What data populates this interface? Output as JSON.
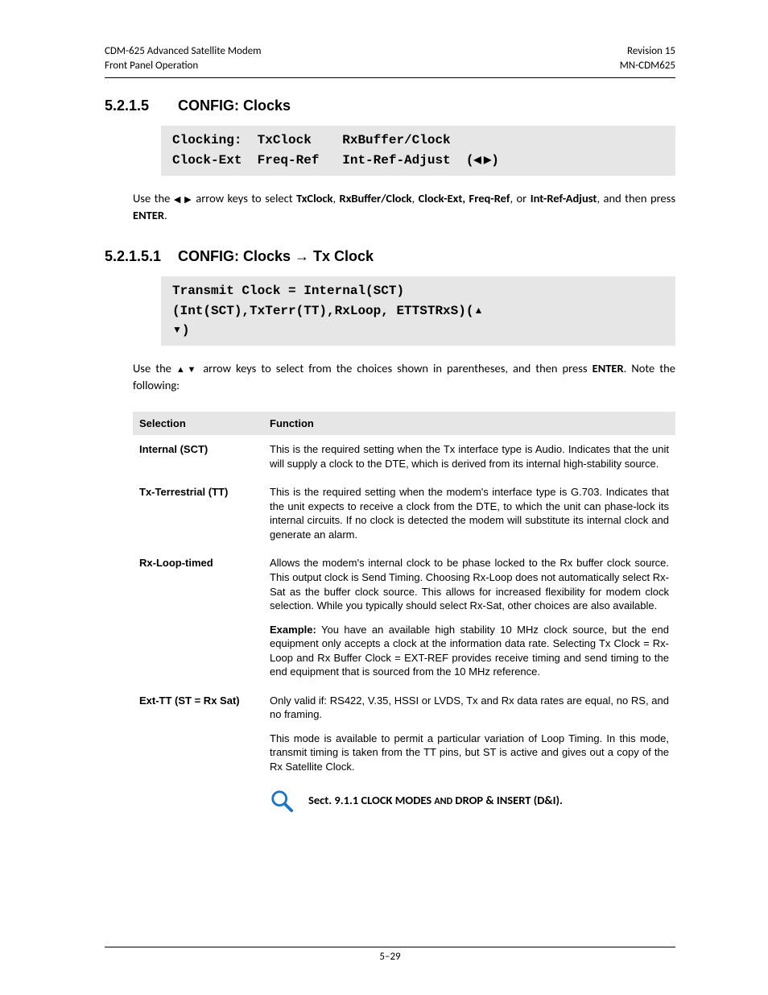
{
  "header": {
    "left_line1": "CDM-625 Advanced Satellite Modem",
    "left_line2": "Front Panel Operation",
    "right_line1": "Revision 15",
    "right_line2": "MN-CDM625"
  },
  "section1": {
    "num": "5.2.1.5",
    "title": "CONFIG: Clocks",
    "lcd_line1": "Clocking:  TxClock    RxBuffer/Clock",
    "lcd_line2_a": "Clock-Ext  Freq-Ref   Int-Ref-Adjust  (",
    "lcd_line2_b": ")",
    "body_a": "Use  the  ",
    "body_arrows": "◀ ▶",
    "body_b": " arrow  keys  to  select  ",
    "opt1": "TxClock",
    "sep1": ",  ",
    "opt2": "RxBuffer/Clock",
    "sep2": ",  ",
    "opt3": "Clock-Ext,  Freq-Ref",
    "sep3": ",  or  ",
    "opt4": "Int-Ref-Adjust",
    "body_c": ", and then press ",
    "enter": "ENTER",
    "body_d": "."
  },
  "section2": {
    "num": "5.2.1.5.1",
    "title_a": "CONFIG: Clocks ",
    "arrow": "→",
    "title_b": " Tx Clock",
    "lcd_line1": "Transmit Clock = Internal(SCT)",
    "lcd_line2_a": "(Int(SCT),TxTerr(TT),RxLoop, ETTSTRxS)(",
    "lcd_line2_b": ")",
    "body_a": "Use  the  ",
    "body_arrows": "▲▼",
    "body_b": "  arrow  keys  to  select  from  the  choices  shown  in  parentheses,  and  then  press ",
    "enter": "ENTER",
    "body_c": ". Note the following:"
  },
  "table": {
    "head_sel": "Selection",
    "head_fun": "Function",
    "rows": [
      {
        "name": "Internal (SCT)",
        "text": "This is the required setting when the Tx interface type is Audio. Indicates that the unit will supply a clock to the DTE, which is derived from its internal high-stability source."
      },
      {
        "name": "Tx-Terrestrial (TT)",
        "text": "This is the required setting when the modem's interface type is G.703. Indicates that the unit expects to receive a clock from the DTE, to which the unit can phase-lock its internal circuits. If no clock is detected the modem will substitute its internal clock and generate an alarm."
      },
      {
        "name": "Rx-Loop-timed",
        "p1": "Allows the modem's internal clock to be phase locked to the Rx buffer clock source. This output clock is Send Timing. Choosing Rx-Loop does not automatically select Rx-Sat as the buffer clock source. This allows for increased flexibility for modem clock selection. While you typically should select Rx-Sat, other choices are also available.",
        "ex_label": "Example:",
        "p2": " You have an available high stability 10 MHz clock source, but the end equipment only accepts a clock at the information data rate. Selecting Tx Clock = Rx-Loop and Rx Buffer Clock = EXT-REF provides receive timing and send timing to the end equipment that is sourced from the 10 MHz reference."
      },
      {
        "name": "Ext-TT (ST = Rx Sat)",
        "p1": "Only valid if: RS422, V.35, HSSI or LVDS, Tx and Rx data rates are equal, no RS, and no framing.",
        "p2": "This mode is available to permit a particular variation of Loop Timing. In this mode, transmit timing is taken from the TT pins, but ST is active and gives out a copy of the Rx Satellite Clock.",
        "ref_a": "Sect. 9.1.1  CLOCK MODES ",
        "ref_and": "AND",
        "ref_b": " DROP & INSERT (D&I)."
      }
    ]
  },
  "footer": {
    "page": "5–29"
  }
}
